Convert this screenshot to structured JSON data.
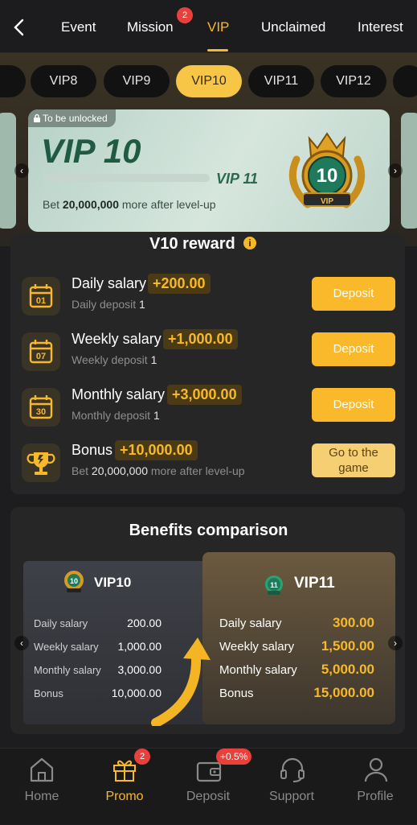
{
  "topnav": {
    "tabs": [
      {
        "label": "Event"
      },
      {
        "label": "Mission",
        "badge": "2"
      },
      {
        "label": "VIP"
      },
      {
        "label": "Unclaimed"
      },
      {
        "label": "Interest"
      }
    ],
    "active": "VIP"
  },
  "levels": [
    "VIP8",
    "VIP9",
    "VIP10",
    "VIP11",
    "VIP12"
  ],
  "active_level": "VIP10",
  "vip_card": {
    "lock_text": "To be unlocked",
    "title": "VIP 10",
    "next_label": "VIP 11",
    "bet_prefix": "Bet",
    "bet_amount": "20,000,000",
    "bet_suffix": "more after level-up",
    "medal_number": "10",
    "medal_ribbon": "VIP",
    "progress": 0
  },
  "reward": {
    "title": "V10 reward",
    "rows": [
      {
        "icon": "calendar-icon",
        "day": "01",
        "title": "Daily salary",
        "amount": "+200.00",
        "sub_label": "Daily deposit",
        "sub_value": "1",
        "button": "Deposit"
      },
      {
        "icon": "calendar-icon",
        "day": "07",
        "title": "Weekly salary",
        "amount": "+1,000.00",
        "sub_label": "Weekly deposit",
        "sub_value": "1",
        "button": "Deposit"
      },
      {
        "icon": "calendar-icon",
        "day": "30",
        "title": "Monthly salary",
        "amount": "+3,000.00",
        "sub_label": "Monthly deposit",
        "sub_value": "1",
        "button": "Deposit"
      },
      {
        "icon": "trophy-icon",
        "title": "Bonus",
        "amount": "+10,000.00",
        "sub_label": "Bet",
        "sub_value": "20,000,000",
        "sub_suffix": "more after level-up",
        "button_line1": "Go to the",
        "button_line2": "game"
      }
    ]
  },
  "comparison": {
    "title": "Benefits comparison",
    "left": {
      "name": "VIP10",
      "medal": "10",
      "rows": [
        {
          "label": "Daily salary",
          "value": "200.00"
        },
        {
          "label": "Weekly salary",
          "value": "1,000.00"
        },
        {
          "label": "Monthly salary",
          "value": "3,000.00"
        },
        {
          "label": "Bonus",
          "value": "10,000.00"
        }
      ]
    },
    "right": {
      "name": "VIP11",
      "medal": "11",
      "rows": [
        {
          "label": "Daily salary",
          "value": "300.00"
        },
        {
          "label": "Weekly salary",
          "value": "1,500.00"
        },
        {
          "label": "Monthly salary",
          "value": "5,000.00"
        },
        {
          "label": "Bonus",
          "value": "15,000.00"
        }
      ]
    }
  },
  "bottomnav": {
    "items": [
      {
        "label": "Home",
        "icon": "home-icon"
      },
      {
        "label": "Promo",
        "icon": "gift-icon",
        "badge": "2"
      },
      {
        "label": "Deposit",
        "icon": "wallet-icon",
        "badge": "+0.5%"
      },
      {
        "label": "Support",
        "icon": "headset-icon"
      },
      {
        "label": "Profile",
        "icon": "user-icon"
      }
    ],
    "active": "Promo"
  },
  "colors": {
    "accent": "#f7b82a",
    "background": "#1d1d1f",
    "panel": "#262626",
    "badge": "#e8413b"
  }
}
